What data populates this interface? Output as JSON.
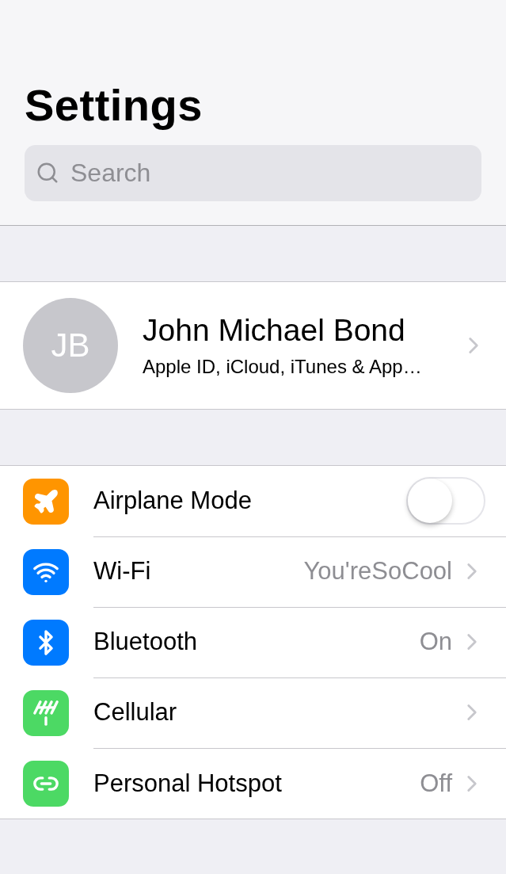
{
  "header": {
    "title": "Settings"
  },
  "search": {
    "placeholder": "Search"
  },
  "profile": {
    "initials": "JB",
    "name": "John Michael Bond",
    "subtitle": "Apple ID, iCloud, iTunes & App…"
  },
  "settings": [
    {
      "kind": "toggle",
      "label": "Airplane Mode",
      "color": "#ff9500",
      "on": false
    },
    {
      "kind": "link",
      "label": "Wi-Fi",
      "value": "You'reSoCool",
      "color": "#007aff"
    },
    {
      "kind": "link",
      "label": "Bluetooth",
      "value": "On",
      "color": "#007aff"
    },
    {
      "kind": "link",
      "label": "Cellular",
      "color": "#4cd964"
    },
    {
      "kind": "link",
      "label": "Personal Hotspot",
      "value": "Off",
      "color": "#4cd964"
    }
  ]
}
